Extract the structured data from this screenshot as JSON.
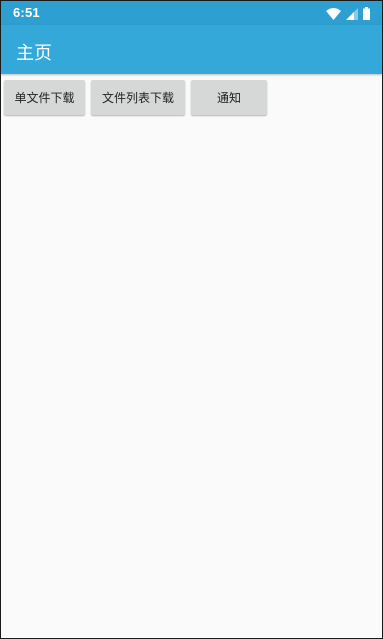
{
  "status_bar": {
    "time": "6:51",
    "icons": [
      "wifi-icon",
      "cellular-signal-icon",
      "battery-icon"
    ]
  },
  "app_bar": {
    "title": "主页"
  },
  "buttons": {
    "single_download": "单文件下载",
    "list_download": "文件列表下载",
    "notify": "通知"
  },
  "colors": {
    "status_bar": "#2e9fd1",
    "app_bar": "#33a8d9",
    "background": "#fafafa",
    "button": "#d6d7d7"
  }
}
